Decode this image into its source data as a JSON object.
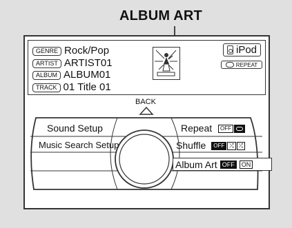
{
  "callout": {
    "label": "ALBUM ART"
  },
  "info": {
    "genre": {
      "tag": "GENRE",
      "value": "Rock/Pop"
    },
    "artist": {
      "tag": "ARTIST",
      "value": "ARTIST01"
    },
    "album": {
      "tag": "ALBUM",
      "value": "ALBUM01"
    },
    "track": {
      "tag": "TRACK",
      "value": "01 Title 01"
    },
    "source": "iPod",
    "repeat_badge": "REPEAT"
  },
  "back_label": "BACK",
  "menu": {
    "sound_setup": "Sound Setup",
    "music_search_setup": "Music Search Setup",
    "repeat": {
      "label": "Repeat",
      "off": "OFF",
      "on_icon": "repeat-icon"
    },
    "shuffle": {
      "label": "Shuffle",
      "off": "OFF",
      "opt1": "shuffle-icon",
      "opt2": "shuffle-all-icon"
    },
    "album_art": {
      "label": "Album Art",
      "off": "OFF",
      "on": "ON"
    }
  }
}
